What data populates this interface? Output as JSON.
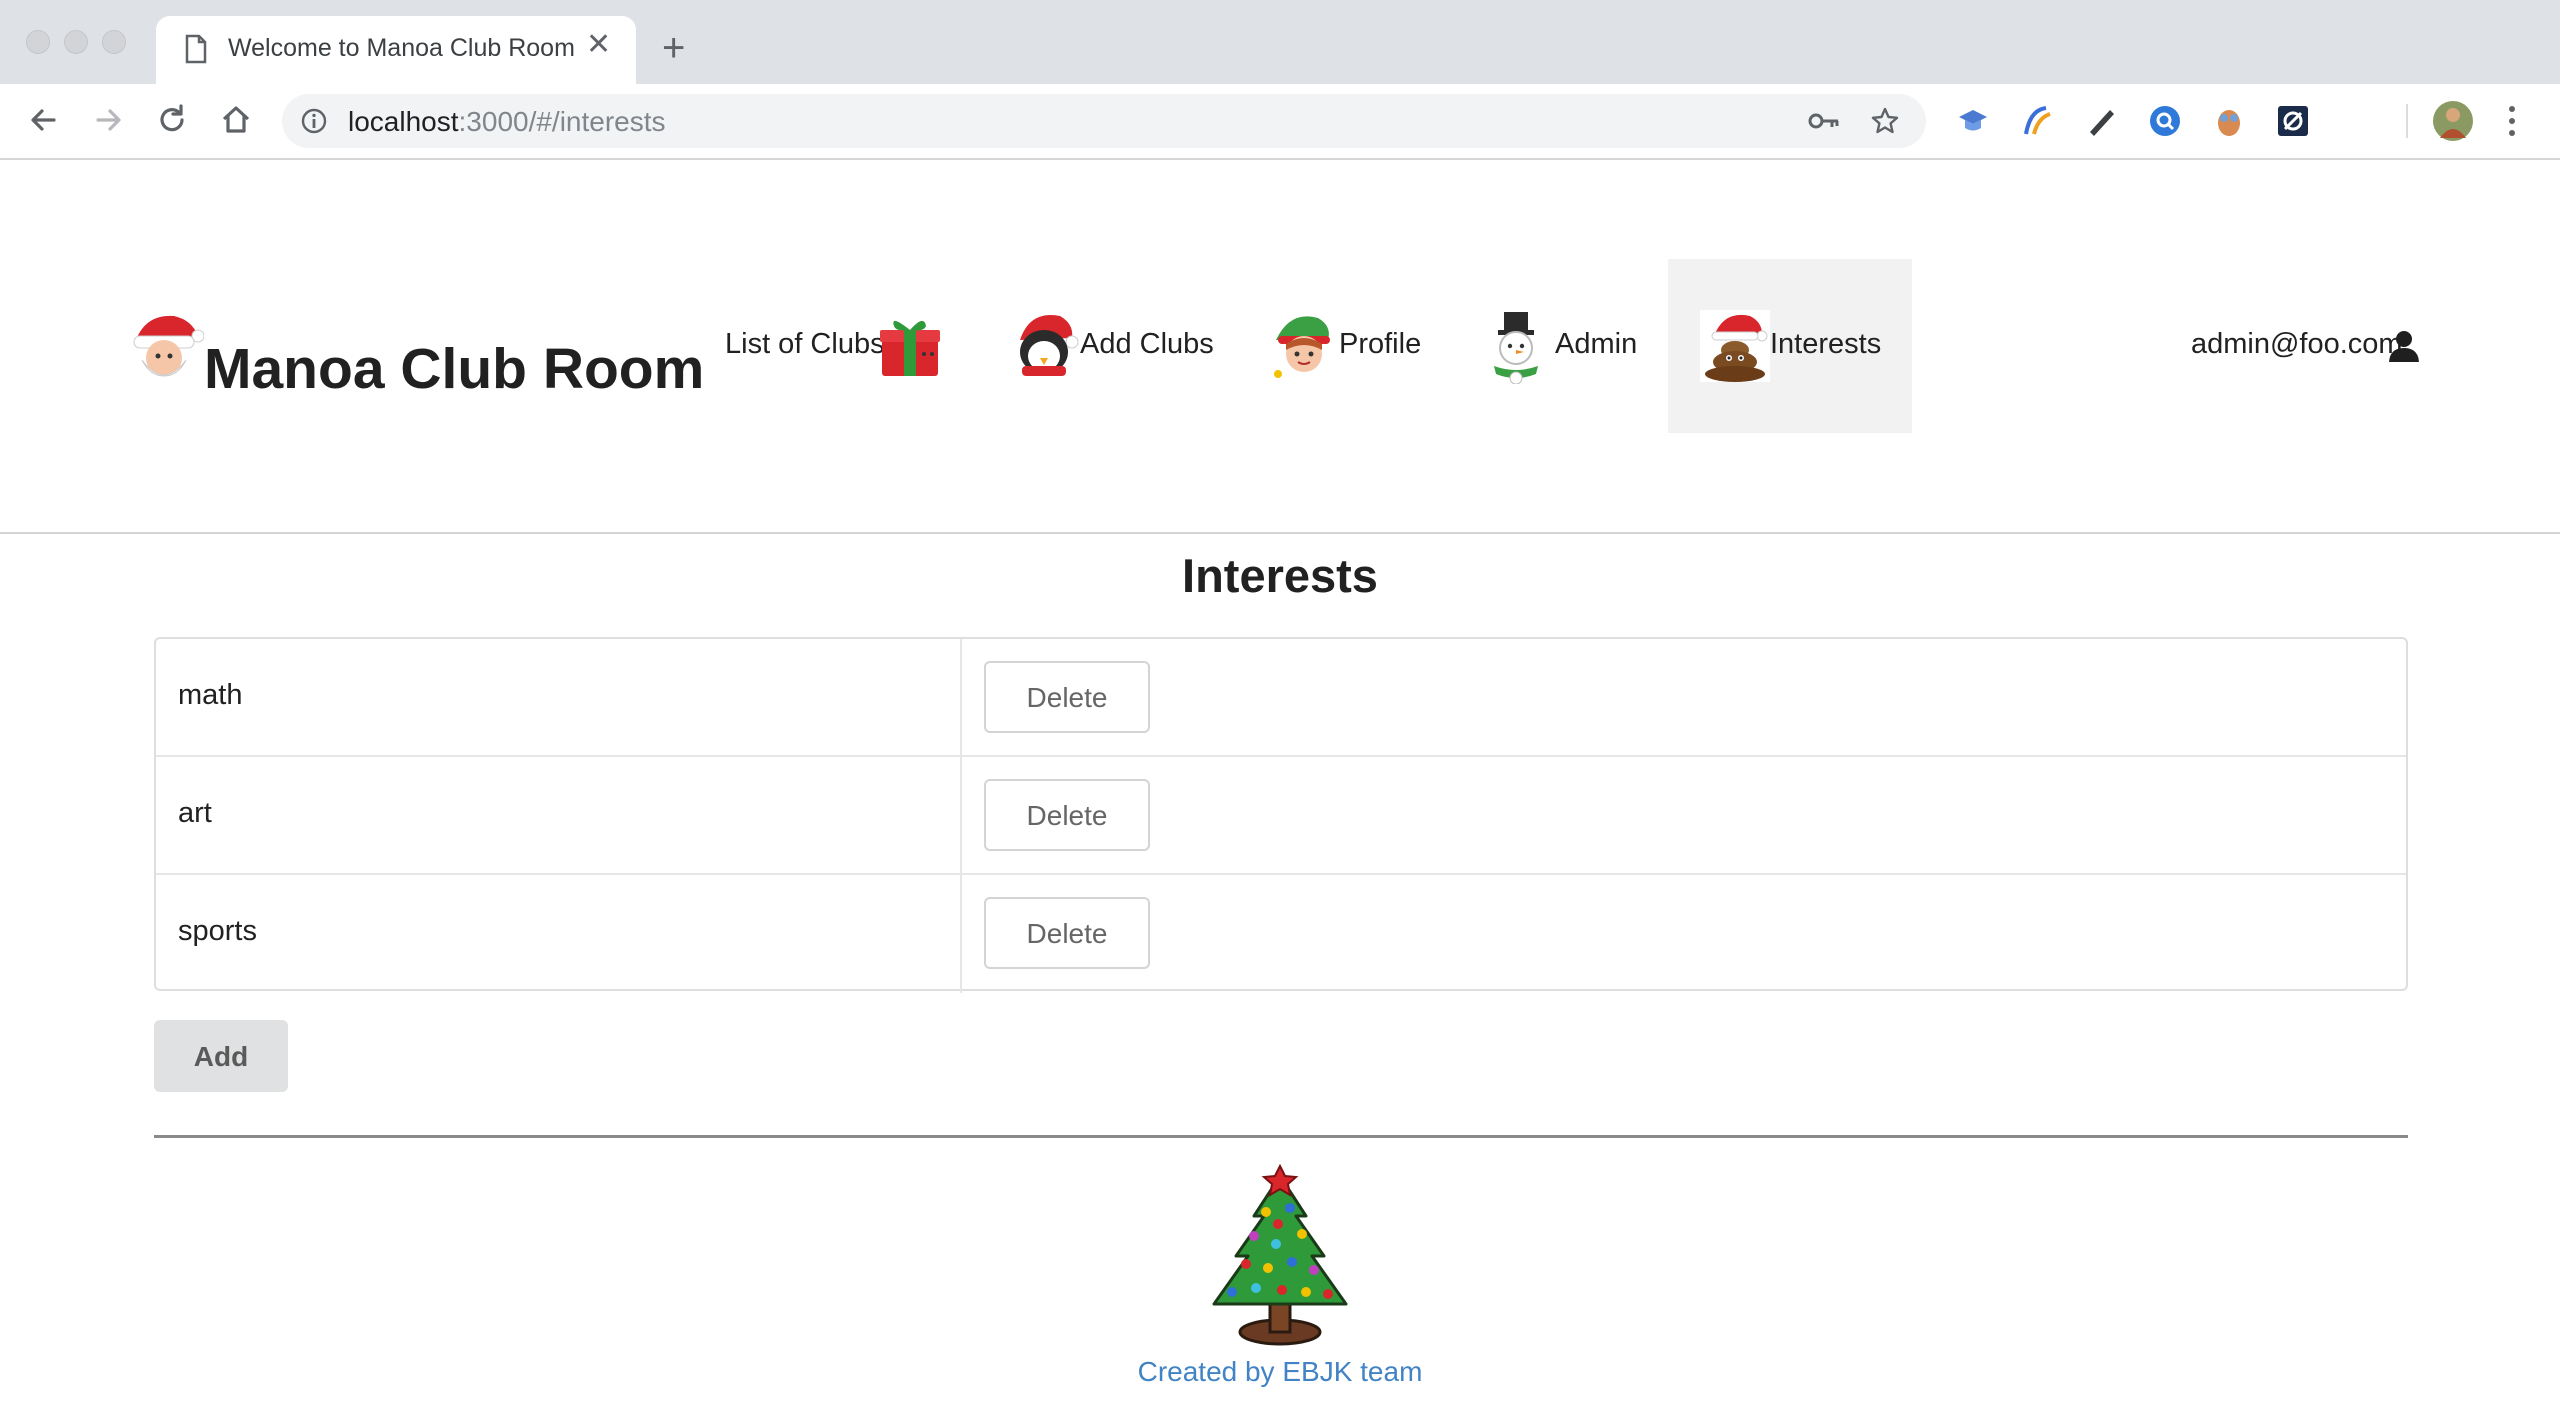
{
  "browser": {
    "tab_title": "Welcome to Manoa Club Room",
    "url_host": "localhost",
    "url_path": ":3000/#/interests"
  },
  "navbar": {
    "brand": "Manoa Club Room",
    "items": [
      {
        "label": "List of Clubs",
        "icon": "gift-icon"
      },
      {
        "label": "Add Clubs",
        "icon": "penguin-santa-icon"
      },
      {
        "label": "Profile",
        "icon": "elf-icon"
      },
      {
        "label": "Admin",
        "icon": "snowman-icon"
      },
      {
        "label": "Interests",
        "icon": "santa-poop-icon",
        "active": true
      }
    ],
    "user": "admin@foo.com"
  },
  "page": {
    "title": "Interests",
    "interests": [
      {
        "name": "math",
        "action": "Delete"
      },
      {
        "name": "art",
        "action": "Delete"
      },
      {
        "name": "sports",
        "action": "Delete"
      }
    ],
    "add_label": "Add"
  },
  "footer": {
    "credit": "Created by EBJK team"
  },
  "colors": {
    "link": "#4183c4",
    "active_menu_bg": "#f2f2f2",
    "add_button_bg": "#e0e1e2"
  }
}
